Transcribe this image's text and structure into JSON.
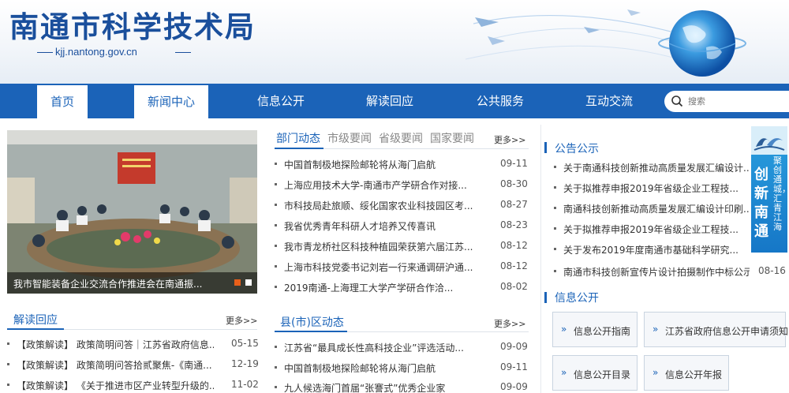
{
  "header": {
    "site_title": "南通市科学技术局",
    "site_url": "kjj.nantong.gov.cn"
  },
  "nav": {
    "items": [
      {
        "label": "首页",
        "active": true
      },
      {
        "label": "新闻中心",
        "active": true
      },
      {
        "label": "信息公开",
        "active": false
      },
      {
        "label": "解读回应",
        "active": false
      },
      {
        "label": "公共服务",
        "active": false
      },
      {
        "label": "互动交流",
        "active": false
      }
    ],
    "search_placeholder": "搜索"
  },
  "slider": {
    "caption": "我市智能装备企业交流合作推进会在南通振..."
  },
  "news_tabs": {
    "tabs": [
      "部门动态",
      "市级要闻",
      "省级要闻",
      "国家要闻"
    ],
    "more": "更多>>",
    "items": [
      {
        "title": "中国首制极地探险邮轮将从海门启航",
        "date": "09-11"
      },
      {
        "title": "上海应用技术大学-南通市产学研合作对接...",
        "date": "08-30"
      },
      {
        "title": "市科技局赴旅顺、绥化国家农业科技园区考...",
        "date": "08-27"
      },
      {
        "title": "我省优秀青年科研人才培养又传喜讯",
        "date": "08-23"
      },
      {
        "title": "我市青龙桥社区科技种植园荣获第六届江苏...",
        "date": "08-12"
      },
      {
        "title": "上海市科技党委书记刘岩一行来通调研沪通...",
        "date": "08-12"
      },
      {
        "title": "2019南通-上海理工大学产学研合作洽...",
        "date": "08-02"
      }
    ]
  },
  "county_news": {
    "title": "县(市)区动态",
    "more": "更多>>",
    "items": [
      {
        "title": "江苏省“最具成长性高科技企业”评选活动...",
        "date": "09-09"
      },
      {
        "title": "中国首制极地探险邮轮将从海门启航",
        "date": "09-11"
      },
      {
        "title": "九人候选海门首届“张謇式”优秀企业家",
        "date": "09-09"
      }
    ]
  },
  "interpret": {
    "title": "解读回应",
    "more": "更多>>",
    "items": [
      {
        "title": "【政策解读】 政策简明问答｜江苏省政府信息...",
        "date": "05-15"
      },
      {
        "title": "【政策解读】 政策简明问答拾贰聚焦-《南通...",
        "date": "12-19"
      },
      {
        "title": "【政策解读】 《关于推进市区产业转型升级的...",
        "date": "11-02"
      }
    ]
  },
  "notice": {
    "title": "公告公示",
    "items": [
      {
        "title": "关于南通科技创新推动高质量发展汇编设计...",
        "date": ""
      },
      {
        "title": "关于拟推荐申报2019年省级企业工程技...",
        "date": ""
      },
      {
        "title": "南通科技创新推动高质量发展汇编设计印刷...",
        "date": ""
      },
      {
        "title": "关于拟推荐申报2019年省级企业工程技...",
        "date": ""
      },
      {
        "title": "关于发布2019年度南通市基础科学研究...",
        "date": ""
      },
      {
        "title": "南通市科技创新宣传片设计拍摄制作中标公示",
        "date": "08-16"
      }
    ]
  },
  "info_public": {
    "title": "信息公开",
    "buttons": [
      "信息公开指南",
      "江苏省政府信息公开申请须知",
      "信息公开目录",
      "信息公开年报"
    ]
  },
  "banner": {
    "line1": "聚创通城，汇青江海",
    "line2": "创新南通"
  },
  "colors": {
    "primary": "#1b63b8",
    "title": "#1a4f9c"
  }
}
